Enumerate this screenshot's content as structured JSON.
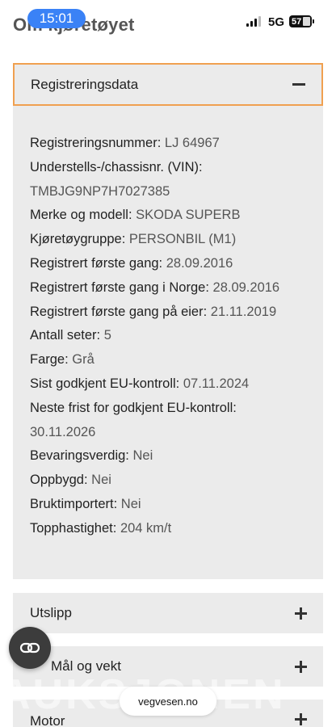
{
  "status_bar": {
    "time": "15:01",
    "network": "5G",
    "battery": "57"
  },
  "page": {
    "title": "Om kjøretøyet"
  },
  "open_section": {
    "title": "Registreringsdata",
    "rows": [
      {
        "label": "Registreringsnummer:",
        "value": "LJ 64967"
      },
      {
        "label": "Understells-/chassisnr. (VIN):",
        "value": ""
      },
      {
        "label": "",
        "value": "TMBJG9NP7H7027385"
      },
      {
        "label": "Merke og modell:",
        "value": "SKODA SUPERB"
      },
      {
        "label": "Kjøretøygruppe:",
        "value": "PERSONBIL (M1)"
      },
      {
        "label": "Registrert første gang:",
        "value": "28.09.2016"
      },
      {
        "label": "Registrert første gang i Norge:",
        "value": "28.09.2016"
      },
      {
        "label": "Registrert første gang på eier:",
        "value": "21.11.2019"
      },
      {
        "label": "Antall seter:",
        "value": "5"
      },
      {
        "label": "Farge:",
        "value": "Grå"
      },
      {
        "label": "Sist godkjent EU-kontroll:",
        "value": "07.11.2024"
      },
      {
        "label": "Neste frist for godkjent EU-kontroll:",
        "value": ""
      },
      {
        "label": "",
        "value": "30.11.2026"
      },
      {
        "label": "Bevaringsverdig:",
        "value": "Nei"
      },
      {
        "label": "Oppbygd:",
        "value": "Nei"
      },
      {
        "label": "Bruktimportert:",
        "value": "Nei"
      },
      {
        "label": "Topphastighet:",
        "value": "204 km/t"
      }
    ]
  },
  "collapsed_sections": [
    {
      "title": "Utslipp"
    },
    {
      "title": "Mål og vekt"
    },
    {
      "title": "Motor"
    }
  ],
  "watermark": "AUKSJONEN",
  "browser": {
    "url": "vegvesen.no"
  },
  "colors": {
    "focus_outline": "#f0a050",
    "panel_bg": "#ebebeb",
    "time_pill": "#3a82f6"
  }
}
